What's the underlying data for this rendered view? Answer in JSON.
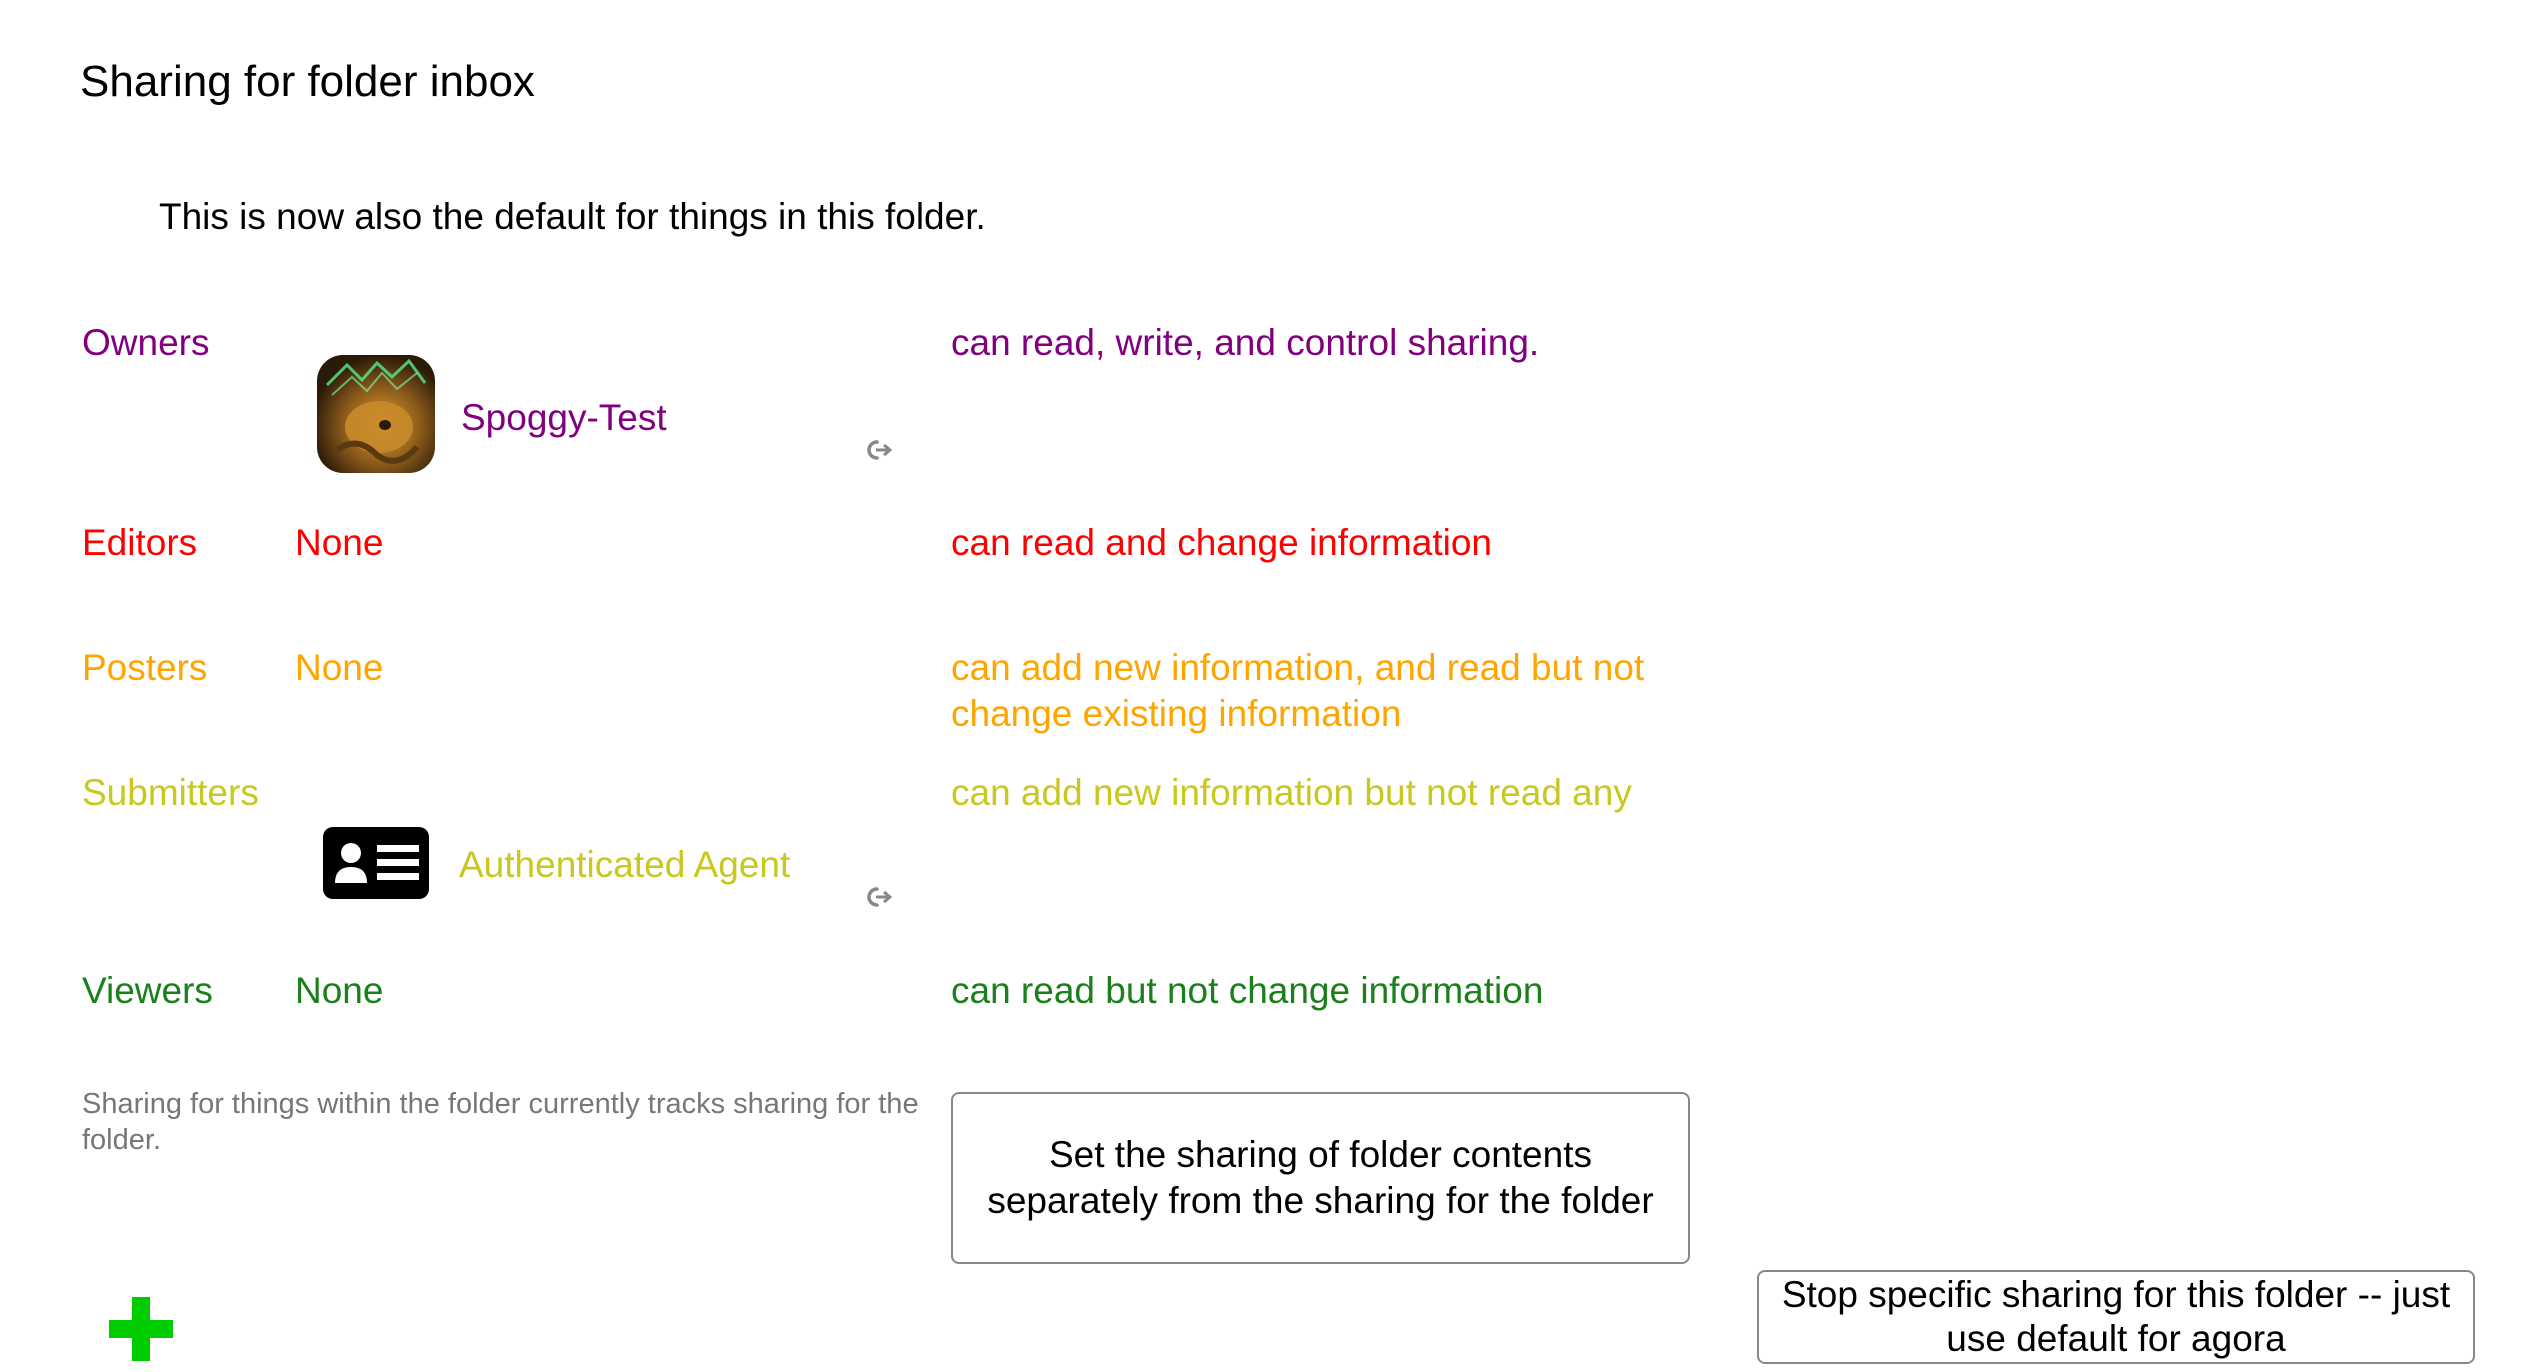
{
  "page": {
    "title": "Sharing for folder inbox",
    "subtitle": "This is now also the default for things in this folder."
  },
  "roles": {
    "owners": {
      "label": "Owners",
      "description": "can read, write, and control sharing.",
      "color": "#800080",
      "agents": [
        {
          "name": "Spoggy-Test",
          "icon": "avatar-image"
        }
      ]
    },
    "editors": {
      "label": "Editors",
      "none": "None",
      "description": "can read and change information",
      "color": "#ff0000"
    },
    "posters": {
      "label": "Posters",
      "none": "None",
      "description": "can add new information, and read but not change existing information",
      "color": "#ffa500"
    },
    "submitters": {
      "label": "Submitters",
      "description": "can add new information but not read any",
      "color": "#c8c81e",
      "agents": [
        {
          "name": "Authenticated Agent",
          "icon": "id-card-icon"
        }
      ]
    },
    "viewers": {
      "label": "Viewers",
      "none": "None",
      "description": "can read but not change information",
      "color": "#1a801a"
    }
  },
  "footer": {
    "note": "Sharing for things within the folder currently tracks sharing for the folder.",
    "set_contents_button": "Set the sharing of folder contents separately from the sharing for the folder",
    "stop_sharing_button": "Stop specific sharing for this folder -- just use default for agora",
    "add_icon": "plus-icon",
    "add_color": "#00cc00"
  },
  "icons": {
    "remove": "unlink-icon"
  }
}
